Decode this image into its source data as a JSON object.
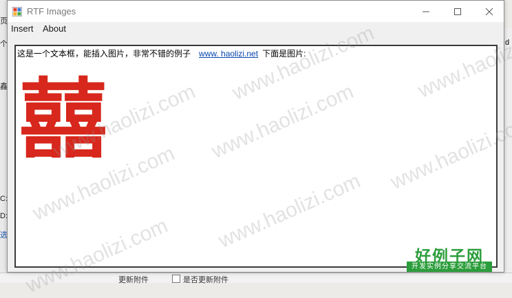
{
  "window": {
    "title": "RTF Images",
    "controls": {
      "minimize": "—",
      "maximize": "☐",
      "close": "✕"
    }
  },
  "menu": {
    "items": [
      "Insert",
      "About"
    ]
  },
  "richtext": {
    "intro": "这是一个文本框，能插入图片，非常不错的例子",
    "link": "www. haolizi.net",
    "after": "下面是图片:",
    "image_char": "囍",
    "image_color": "#d8271c"
  },
  "watermark": {
    "text": "www.haolizi.com",
    "logo_title": "好例子网",
    "logo_subtitle": "开发实例分享交流平台",
    "logo_color": "#2b9d3b"
  },
  "background_app": {
    "left_fragments": [
      "页",
      "个",
      "鑫",
      "C:",
      "D:",
      "选"
    ],
    "right_fragment": "d",
    "bottom_label": "更新附件",
    "bottom_checkbox_label": "是否更新附件"
  }
}
